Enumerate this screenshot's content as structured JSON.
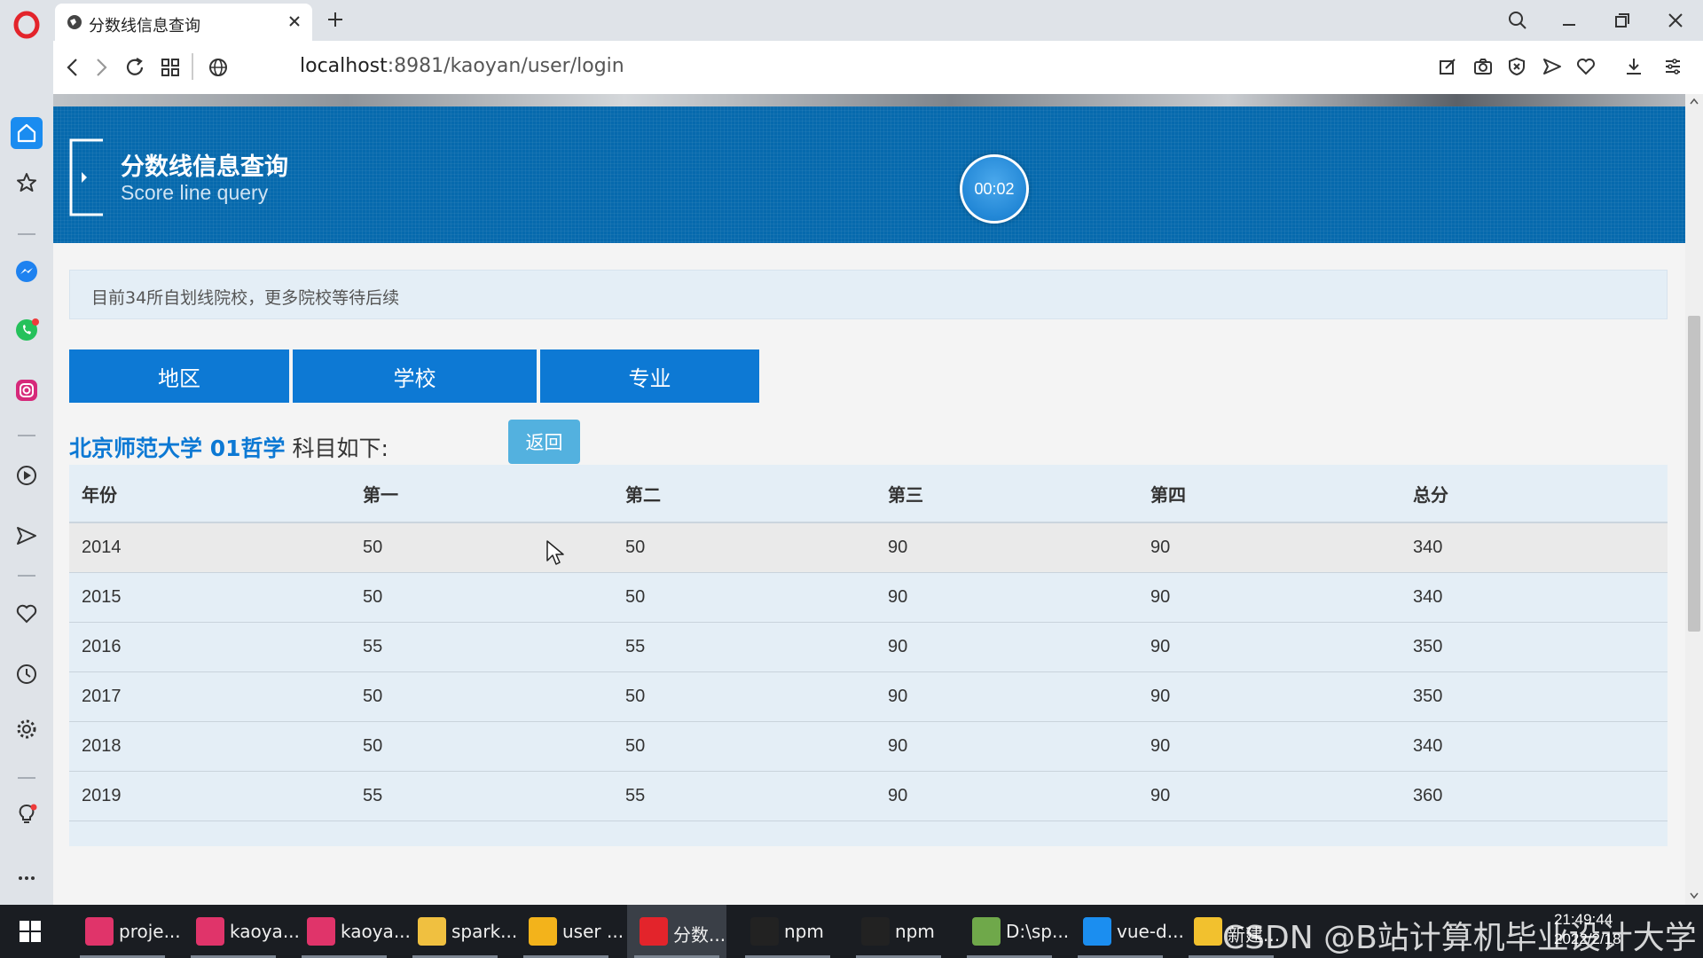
{
  "browser": {
    "tab_title": "分数线信息查询",
    "url_host": "localhost",
    "url_path": ":8981/kaoyan/user/login"
  },
  "page": {
    "banner_title": "分数线信息查询",
    "banner_subtitle": "Score line query",
    "timer": "00:02",
    "notice": "目前34所自划线院校，更多院校等待后续",
    "filters": [
      "地区",
      "学校",
      "专业"
    ],
    "result_school_major": "北京师范大学 01哲学",
    "result_suffix": "科目如下:",
    "back_label": "返回",
    "table": {
      "headers": [
        "年份",
        "第一",
        "第二",
        "第三",
        "第四",
        "总分"
      ],
      "rows": [
        [
          "2014",
          "50",
          "50",
          "90",
          "90",
          "340"
        ],
        [
          "2015",
          "50",
          "50",
          "90",
          "90",
          "340"
        ],
        [
          "2016",
          "55",
          "55",
          "90",
          "90",
          "350"
        ],
        [
          "2017",
          "50",
          "50",
          "90",
          "90",
          "350"
        ],
        [
          "2018",
          "50",
          "50",
          "90",
          "90",
          "340"
        ],
        [
          "2019",
          "55",
          "55",
          "90",
          "90",
          "360"
        ]
      ]
    }
  },
  "taskbar": {
    "apps": [
      {
        "label": "proje...",
        "icon": "intellij-icon",
        "color": "#e0346a"
      },
      {
        "label": "kaoya...",
        "icon": "intellij-icon",
        "color": "#e0346a"
      },
      {
        "label": "kaoya...",
        "icon": "intellij-icon",
        "color": "#e0346a"
      },
      {
        "label": "spark...",
        "icon": "folder-icon",
        "color": "#f0c040"
      },
      {
        "label": "user ...",
        "icon": "app-icon",
        "color": "#f3b31b"
      },
      {
        "label": "分数...",
        "icon": "opera-icon",
        "color": "#e3242b"
      },
      {
        "label": "npm",
        "icon": "terminal-icon",
        "color": "#222222"
      },
      {
        "label": "npm",
        "icon": "terminal-icon",
        "color": "#222222"
      },
      {
        "label": "D:\\sp...",
        "icon": "notepad-icon",
        "color": "#6fa84a"
      },
      {
        "label": "vue-d...",
        "icon": "browser-icon",
        "color": "#1b8ef0"
      },
      {
        "label": "新建...",
        "icon": "chrome-icon",
        "color": "#f2c12e"
      }
    ],
    "time": "21:49:44",
    "date": "2022/2/18",
    "watermark": "CSDN @B站计算机毕业设计大学"
  }
}
